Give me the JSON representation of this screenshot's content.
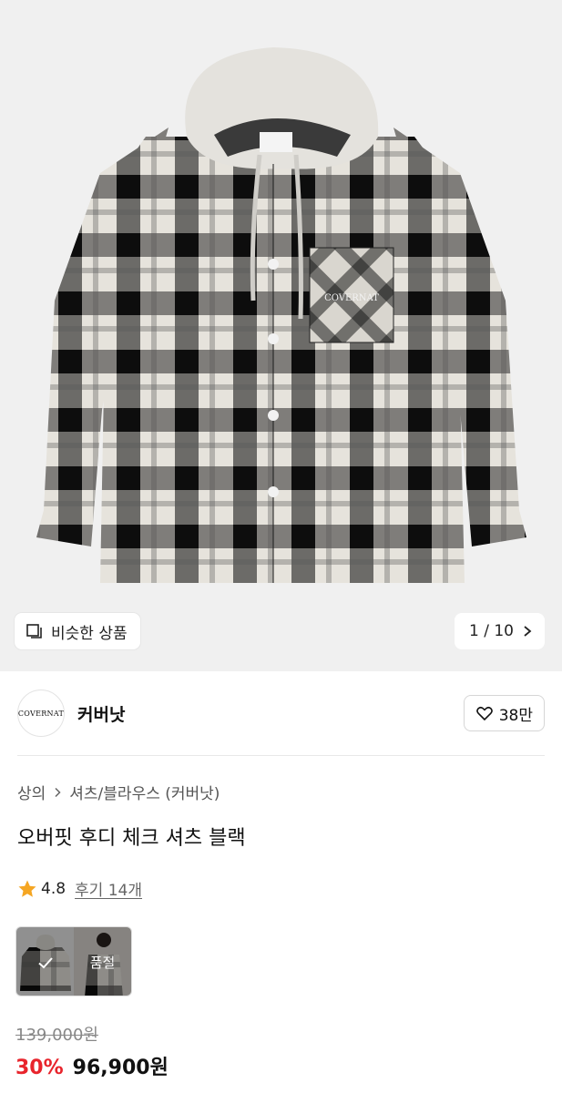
{
  "gallery": {
    "similar_label": "비슷한 상품",
    "counter": "1 / 10",
    "image_alt": "product-photo-plaid-hoodie-shirt"
  },
  "brand": {
    "logo_text": "COVERNAT",
    "name": "커버낫",
    "like_count": "38만"
  },
  "breadcrumb": {
    "level1": "상의",
    "level2": "셔츠/블라우스 (커버낫)"
  },
  "product": {
    "title": "오버핏 후디 체크 셔츠 블랙",
    "rating": "4.8",
    "reviews": "후기 14개"
  },
  "options": {
    "selected_index": 0,
    "soldout_label": "품절"
  },
  "price": {
    "original": "139,000원",
    "discount": "30%",
    "sale": "96,900원"
  },
  "colors": {
    "accent_red": "#e8242c",
    "star": "#f5a623",
    "gallery_bg": "#f0f0f0"
  }
}
